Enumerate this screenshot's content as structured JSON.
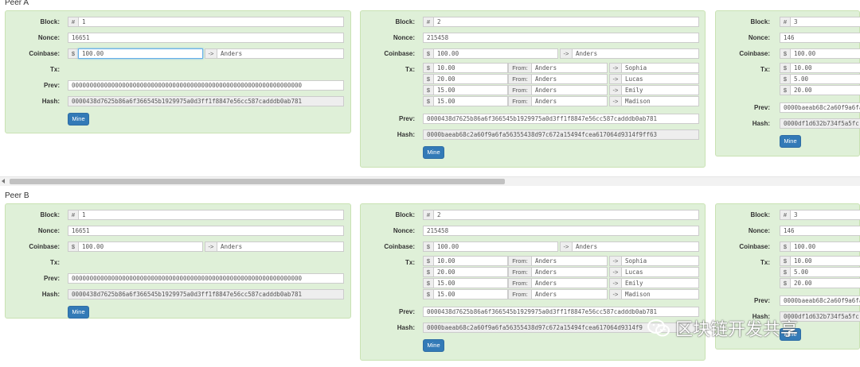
{
  "peers": [
    {
      "title": "Peer A",
      "blocks": [
        {
          "block": "1",
          "nonce": "16651",
          "coinbase_amount": "100.00",
          "coinbase_to": "Anders",
          "txs": [],
          "prev": "0000000000000000000000000000000000000000000000000000000000000000",
          "hash": "0000438d7625b86a6f366545b1929975a0d3ff1f8847e56cc587cadddb0ab781"
        },
        {
          "block": "2",
          "nonce": "215458",
          "coinbase_amount": "100.00",
          "coinbase_to": "Anders",
          "txs": [
            {
              "amount": "10.00",
              "from": "Anders",
              "to": "Sophia"
            },
            {
              "amount": "20.00",
              "from": "Anders",
              "to": "Lucas"
            },
            {
              "amount": "15.00",
              "from": "Anders",
              "to": "Emily"
            },
            {
              "amount": "15.00",
              "from": "Anders",
              "to": "Madison"
            }
          ],
          "prev": "0000438d7625b86a6f366545b1929975a0d3ff1f8847e56cc587cadddb0ab781",
          "hash": "0000baeab68c2a60f9a6fa56355438d97c672a15494fcea617064d9314f9ff63"
        },
        {
          "block": "3",
          "nonce": "146",
          "coinbase_amount": "100.00",
          "txs": [
            {
              "amount": "10.00"
            },
            {
              "amount": "5.00"
            },
            {
              "amount": "20.00"
            }
          ],
          "prev": "0000baeab68c2a60f9a6fa",
          "hash": "0000df1d632b734f5a5fc"
        }
      ]
    },
    {
      "title": "Peer B",
      "blocks": [
        {
          "block": "1",
          "nonce": "16651",
          "coinbase_amount": "100.00",
          "coinbase_to": "Anders",
          "txs": [],
          "prev": "0000000000000000000000000000000000000000000000000000000000000000",
          "hash": "0000438d7625b86a6f366545b1929975a0d3ff1f8847e56cc587cadddb0ab781"
        },
        {
          "block": "2",
          "nonce": "215458",
          "coinbase_amount": "100.00",
          "coinbase_to": "Anders",
          "txs": [
            {
              "amount": "10.00",
              "from": "Anders",
              "to": "Sophia"
            },
            {
              "amount": "20.00",
              "from": "Anders",
              "to": "Lucas"
            },
            {
              "amount": "15.00",
              "from": "Anders",
              "to": "Emily"
            },
            {
              "amount": "15.00",
              "from": "Anders",
              "to": "Madison"
            }
          ],
          "prev": "0000438d7625b86a6f366545b1929975a0d3ff1f8847e56cc587cadddb0ab781",
          "hash": "0000baeab68c2a60f9a6fa56355438d97c672a15494fcea617064d9314f9"
        },
        {
          "block": "3",
          "nonce": "146",
          "coinbase_amount": "100.00",
          "txs": [
            {
              "amount": "10.00"
            },
            {
              "amount": "5.00"
            },
            {
              "amount": "20.00"
            }
          ],
          "prev": "0000baeab68c2a60f9a6fa",
          "hash": "0000df1d632b734f5a5fc"
        }
      ]
    }
  ],
  "labels": {
    "block": "Block:",
    "nonce": "Nonce:",
    "coinbase": "Coinbase:",
    "tx": "Tx:",
    "prev": "Prev:",
    "hash": "Hash:",
    "hash_sign": "#",
    "dollar": "$",
    "arrow": "->",
    "from": "From:",
    "mine": "Mine"
  },
  "watermark": {
    "text": "区块链开发共享",
    "icon": "wechat-icon"
  },
  "colors": {
    "block_bg": "#dff0d8",
    "button": "#337ab7"
  }
}
